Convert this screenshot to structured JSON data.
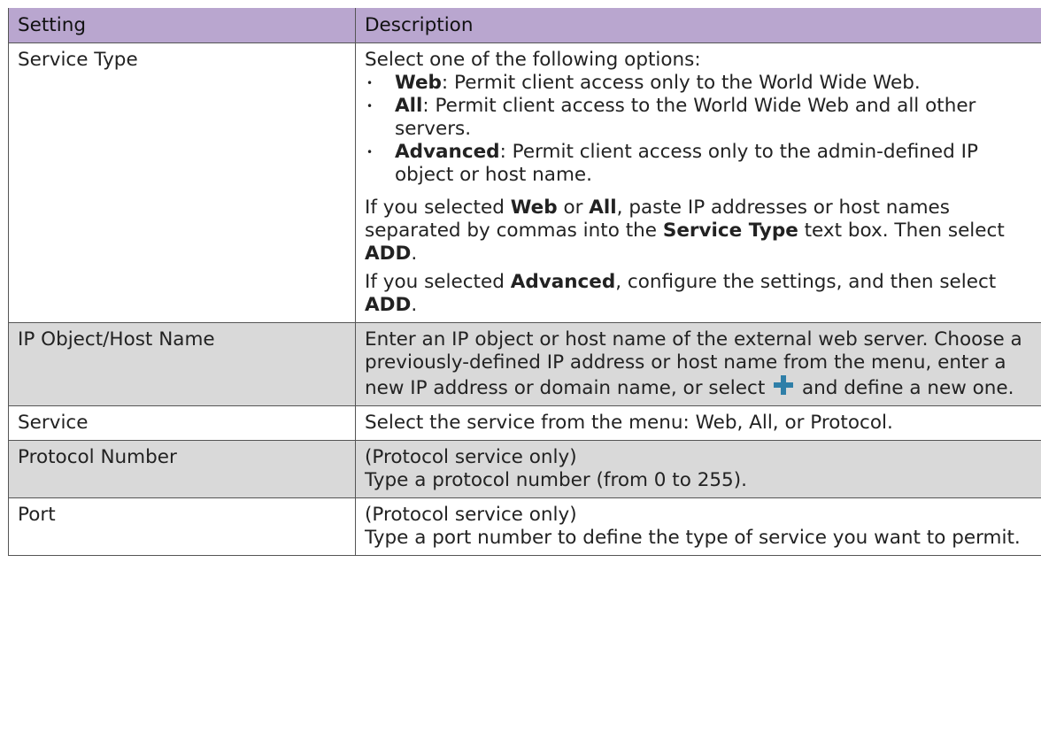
{
  "table": {
    "headers": [
      "Setting",
      "Description"
    ],
    "rows": {
      "service_type": {
        "setting": "Service Type",
        "intro": "Select one of the following options:",
        "options": [
          {
            "name": "Web",
            "text": ": Permit client access only to the World Wide Web."
          },
          {
            "name": "All",
            "text": ": Permit client access to the World Wide Web and all other servers."
          },
          {
            "name": "Advanced",
            "text": ": Permit client access only to the admin-defined IP object or host name."
          }
        ],
        "note1": {
          "t1": "If you selected ",
          "b1": "Web",
          "t2": " or ",
          "b2": "All",
          "t3": ", paste IP addresses or host names separated by commas into the ",
          "b3": "Service Type",
          "t4": " text box. Then select ",
          "b4": "ADD",
          "t5": "."
        },
        "note2": {
          "t1": "If you selected ",
          "b1": "Advanced",
          "t2": ", configure the settings, and then select ",
          "b2": "ADD",
          "t3": "."
        }
      },
      "ip_object": {
        "setting": "IP Object/Host Name",
        "text1": "Enter an IP object or host name of the external web server. Choose a previously-defined IP address or host name from the menu, enter a new IP address or domain name, or select",
        "text2": "and define a new one.",
        "icon": "plus-icon",
        "icon_color": "#2f7fa8"
      },
      "service": {
        "setting": "Service",
        "text": "Select the service from the menu: Web, All, or Protocol."
      },
      "protocol_number": {
        "setting": "Protocol Number",
        "line1": "(Protocol service only)",
        "line2": "Type a protocol number (from 0 to 255)."
      },
      "port": {
        "setting": "Port",
        "line1": "(Protocol service only)",
        "line2": "Type a port number to define the type of service you want to permit."
      }
    }
  },
  "colors": {
    "header_bg": "#b9a6cf",
    "shaded_row_bg": "#d9d9d9",
    "border": "#555555"
  }
}
